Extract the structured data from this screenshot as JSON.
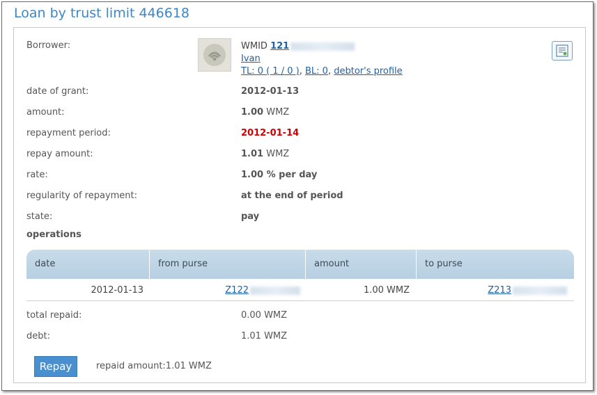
{
  "title": "Loan by trust limit 446618",
  "borrower": {
    "label": "Borrower:",
    "wmid_label": "WMID",
    "wmid_visible": "121",
    "name": "Ivan",
    "tl_text": "TL: 0 ( 1 / 0 )",
    "sep1": ",",
    "bl_text": "BL: 0",
    "sep2": ",",
    "profile_link": "debtor's profile"
  },
  "fields": [
    {
      "label": "date of grant:",
      "value": "2012-01-13"
    },
    {
      "label": "amount:",
      "value": "1.00",
      "unit": "WMZ"
    },
    {
      "label": "repayment period:",
      "value": "2012-01-14"
    },
    {
      "label": "repay amount:",
      "value": "1.01",
      "unit": "WMZ"
    },
    {
      "label": "rate:",
      "value": "1.00 % per day"
    },
    {
      "label": "regularity of repayment:",
      "value": "at the end of period"
    },
    {
      "label": "state:",
      "value": "pay"
    }
  ],
  "operations": {
    "title": "operations",
    "columns": [
      "date",
      "from purse",
      "amount",
      "to purse"
    ],
    "rows": [
      {
        "date": "2012-01-13",
        "from_purse": "Z122",
        "amount": "1.00 WMZ",
        "to_purse": "Z213"
      }
    ]
  },
  "totals": [
    {
      "label": "total repaid:",
      "value": "0.00 WMZ"
    },
    {
      "label": "debt:",
      "value": "1.01 WMZ"
    }
  ],
  "repay": {
    "button_label": "Repay",
    "note": "repaid amount:1.01 WMZ"
  },
  "colors": {
    "accent": "#3d86c6",
    "overdue": "#d00000",
    "button": "#4a90cf"
  },
  "icons": [
    "avatar-icon",
    "certificate-icon"
  ]
}
